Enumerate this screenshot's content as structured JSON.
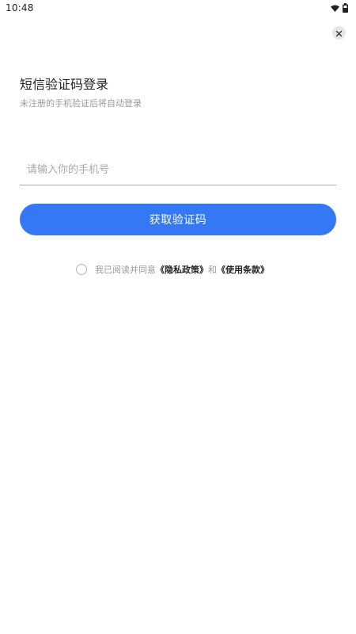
{
  "status_bar": {
    "time": "10:48",
    "icons": [
      "wifi-icon",
      "battery-icon"
    ]
  },
  "close_icon": "close-icon",
  "login": {
    "title": "短信验证码登录",
    "subtitle": "未注册的手机验证后将自动登录",
    "phone_placeholder": "请输入你的手机号",
    "get_code_label": "获取验证码"
  },
  "agreement": {
    "checked": false,
    "prefix": "我已阅读并同意",
    "privacy_link": "《隐私政策》",
    "connector": "和",
    "terms_link": "《使用条款》"
  },
  "colors": {
    "primary": "#3478f6",
    "title": "#222222",
    "muted": "#9a9a9a",
    "divider": "#a9a9a9",
    "background": "#ffffff"
  }
}
